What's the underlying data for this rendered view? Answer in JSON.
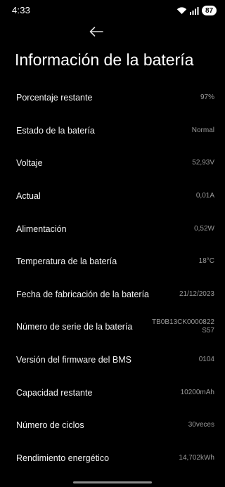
{
  "status_bar": {
    "time": "4:33",
    "battery_level": "87"
  },
  "header": {
    "title": "Información de la batería"
  },
  "rows": [
    {
      "label": "Porcentaje restante",
      "value": "97%"
    },
    {
      "label": "Estado de la batería",
      "value": "Normal"
    },
    {
      "label": "Voltaje",
      "value": "52,93V"
    },
    {
      "label": "Actual",
      "value": "0,01A"
    },
    {
      "label": "Alimentación",
      "value": "0,52W"
    },
    {
      "label": "Temperatura de la batería",
      "value": "18°C"
    },
    {
      "label": "Fecha de fabricación de la batería",
      "value": "21/12/2023"
    },
    {
      "label": "Número de serie de la batería",
      "value": "TB0B13CK0000822S57"
    },
    {
      "label": "Versión del firmware del BMS",
      "value": "0104"
    },
    {
      "label": "Capacidad restante",
      "value": "10200mAh"
    },
    {
      "label": "Número de ciclos",
      "value": "30veces"
    },
    {
      "label": "Rendimiento energético",
      "value": "14,702kWh"
    }
  ],
  "icons": {
    "back": "back-arrow-icon",
    "wifi": "wifi-icon",
    "signal": "cellular-signal-icon",
    "battery": "battery-icon"
  },
  "colors": {
    "background": "#000000",
    "label_text": "#f2f2f2",
    "value_text": "#9a9a9a"
  }
}
